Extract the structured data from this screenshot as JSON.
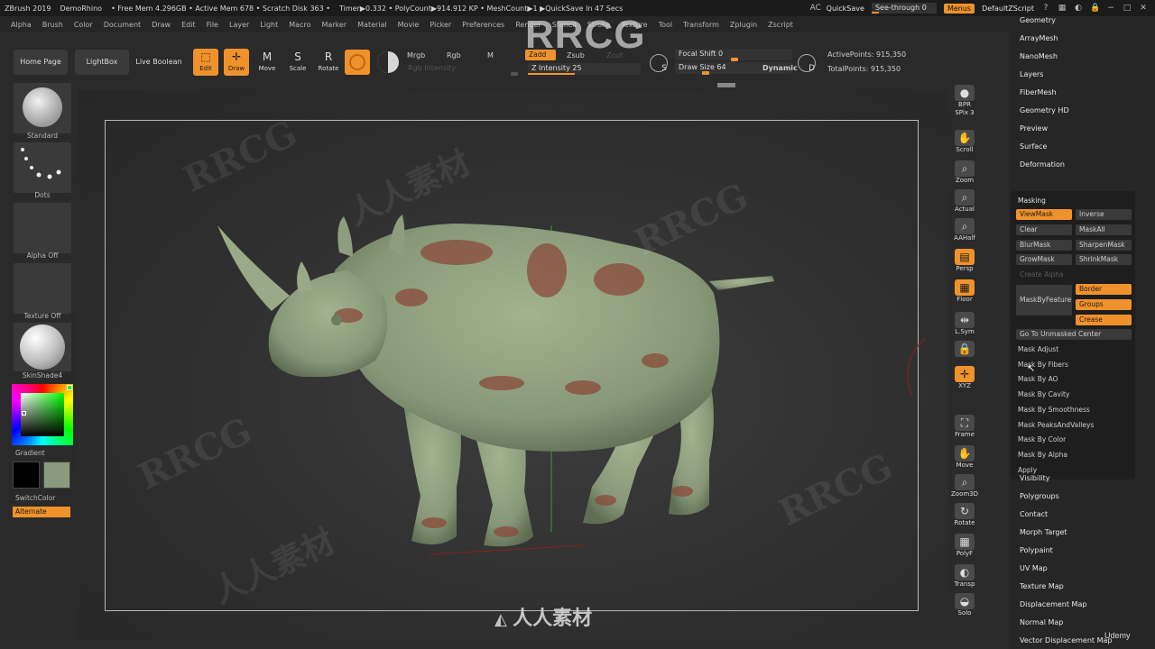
{
  "titlebar": {
    "items": [
      "ZBrush 2019",
      "DemoRhino",
      "• Free Mem 4.296GB • Active Mem 678 • Scratch Disk 363 •",
      "Timer▶0.332 • PolyCount▶914.912 KP • MeshCount▶1 ▶QuickSave In 47 Secs"
    ],
    "quicksave": "QuickSave",
    "see_through": "See-through  0",
    "menus": "Menus",
    "script": "DefaultZScript"
  },
  "menubar": [
    "Alpha",
    "Brush",
    "Color",
    "Document",
    "Draw",
    "Edit",
    "File",
    "Layer",
    "Light",
    "Macro",
    "Marker",
    "Material",
    "Movie",
    "Picker",
    "Preferences",
    "Render",
    "Stencil",
    "Stroke",
    "Texture",
    "Tool",
    "Transform",
    "Zplugin",
    "Zscript"
  ],
  "toolbar": {
    "home": "Home Page",
    "lightbox": "LightBox",
    "live_boolean": "Live Boolean",
    "edit": "Edit",
    "draw": "Draw",
    "move": "Move",
    "scale": "Scale",
    "rotate": "Rotate",
    "mrgb": "Mrgb",
    "rgb": "Rgb",
    "m": "M",
    "rgb_intensity": "Rgb Intensity",
    "zadd": "Zadd",
    "zsub": "Zsub",
    "zcut": "Zcut",
    "z_intensity": "Z Intensity 25",
    "z_intensity_value": 25,
    "focal_shift": "Focal Shift 0",
    "draw_size": "Draw Size 64",
    "draw_size_value": 64,
    "dynamic": "Dynamic",
    "active_points": "ActivePoints: 915,350",
    "total_points": "TotalPoints: 915,350"
  },
  "leftshelf": {
    "brush": "Standard",
    "stroke": "Dots",
    "alpha": "Alpha Off",
    "texture": "Texture Off",
    "material": "SkinShade4",
    "gradient": "Gradient",
    "switch_color": "SwitchColor",
    "alternate": "Alternate",
    "colors": {
      "primary": "#000000",
      "secondary": "#8a9a7c",
      "picker_hue": "#00ff00"
    }
  },
  "rightshelf": [
    {
      "id": "bpr",
      "label": "BPR",
      "sub": "SPix 3"
    },
    {
      "id": "scroll",
      "label": "Scroll"
    },
    {
      "id": "zoom",
      "label": "Zoom"
    },
    {
      "id": "actual",
      "label": "Actual"
    },
    {
      "id": "aahalf",
      "label": "AAHalf"
    },
    {
      "id": "persp",
      "label": "Persp"
    },
    {
      "id": "floor",
      "label": "Floor"
    },
    {
      "id": "lsym",
      "label": "L.Sym"
    },
    {
      "id": "lock",
      "label": ""
    },
    {
      "id": "xyz",
      "label": "XYZ"
    },
    {
      "id": "frame",
      "label": "Frame"
    },
    {
      "id": "move",
      "label": "Move"
    },
    {
      "id": "zoom3d",
      "label": "Zoom3D"
    },
    {
      "id": "rotate",
      "label": "Rotate"
    },
    {
      "id": "polyf",
      "label": "PolyF"
    },
    {
      "id": "transp",
      "label": "Transp"
    },
    {
      "id": "solo",
      "label": "Solo"
    }
  ],
  "palette": {
    "items_top": [
      "Geometry",
      "ArrayMesh",
      "NanoMesh",
      "Layers",
      "FiberMesh",
      "Geometry HD",
      "Preview",
      "Surface",
      "Deformation"
    ],
    "masking": {
      "title": "Masking",
      "view_mask": "ViewMask",
      "inverse": "Inverse",
      "clear": "Clear",
      "mask_all": "MaskAll",
      "blur_mask": "BlurMask",
      "sharpen_mask": "SharpenMask",
      "grow_mask": "GrowMask",
      "shrink_mask": "ShrinkMask",
      "create_alpha": "Create Alpha",
      "mask_by_feature": "MaskByFeature",
      "border": "Border",
      "groups": "Groups",
      "crease": "Crease",
      "go_to_unmasked": "Go To Unmasked Center",
      "rows": [
        "Mask Adjust",
        "Mask By Fibers",
        "Mask By AO",
        "Mask By Cavity",
        "Mask By Smoothness",
        "Mask PeaksAndValleys",
        "Mask By Color",
        "Mask By Alpha",
        "Apply"
      ]
    },
    "items_bottom": [
      "Visibility",
      "Polygroups",
      "Contact",
      "Morph Target",
      "Polypaint",
      "UV Map",
      "Texture Map",
      "Displacement Map",
      "Normal Map",
      "Vector Displacement Map"
    ]
  },
  "watermarks": {
    "brand": "RRCG",
    "cn": "人人素材",
    "udemy": "Udemy"
  }
}
